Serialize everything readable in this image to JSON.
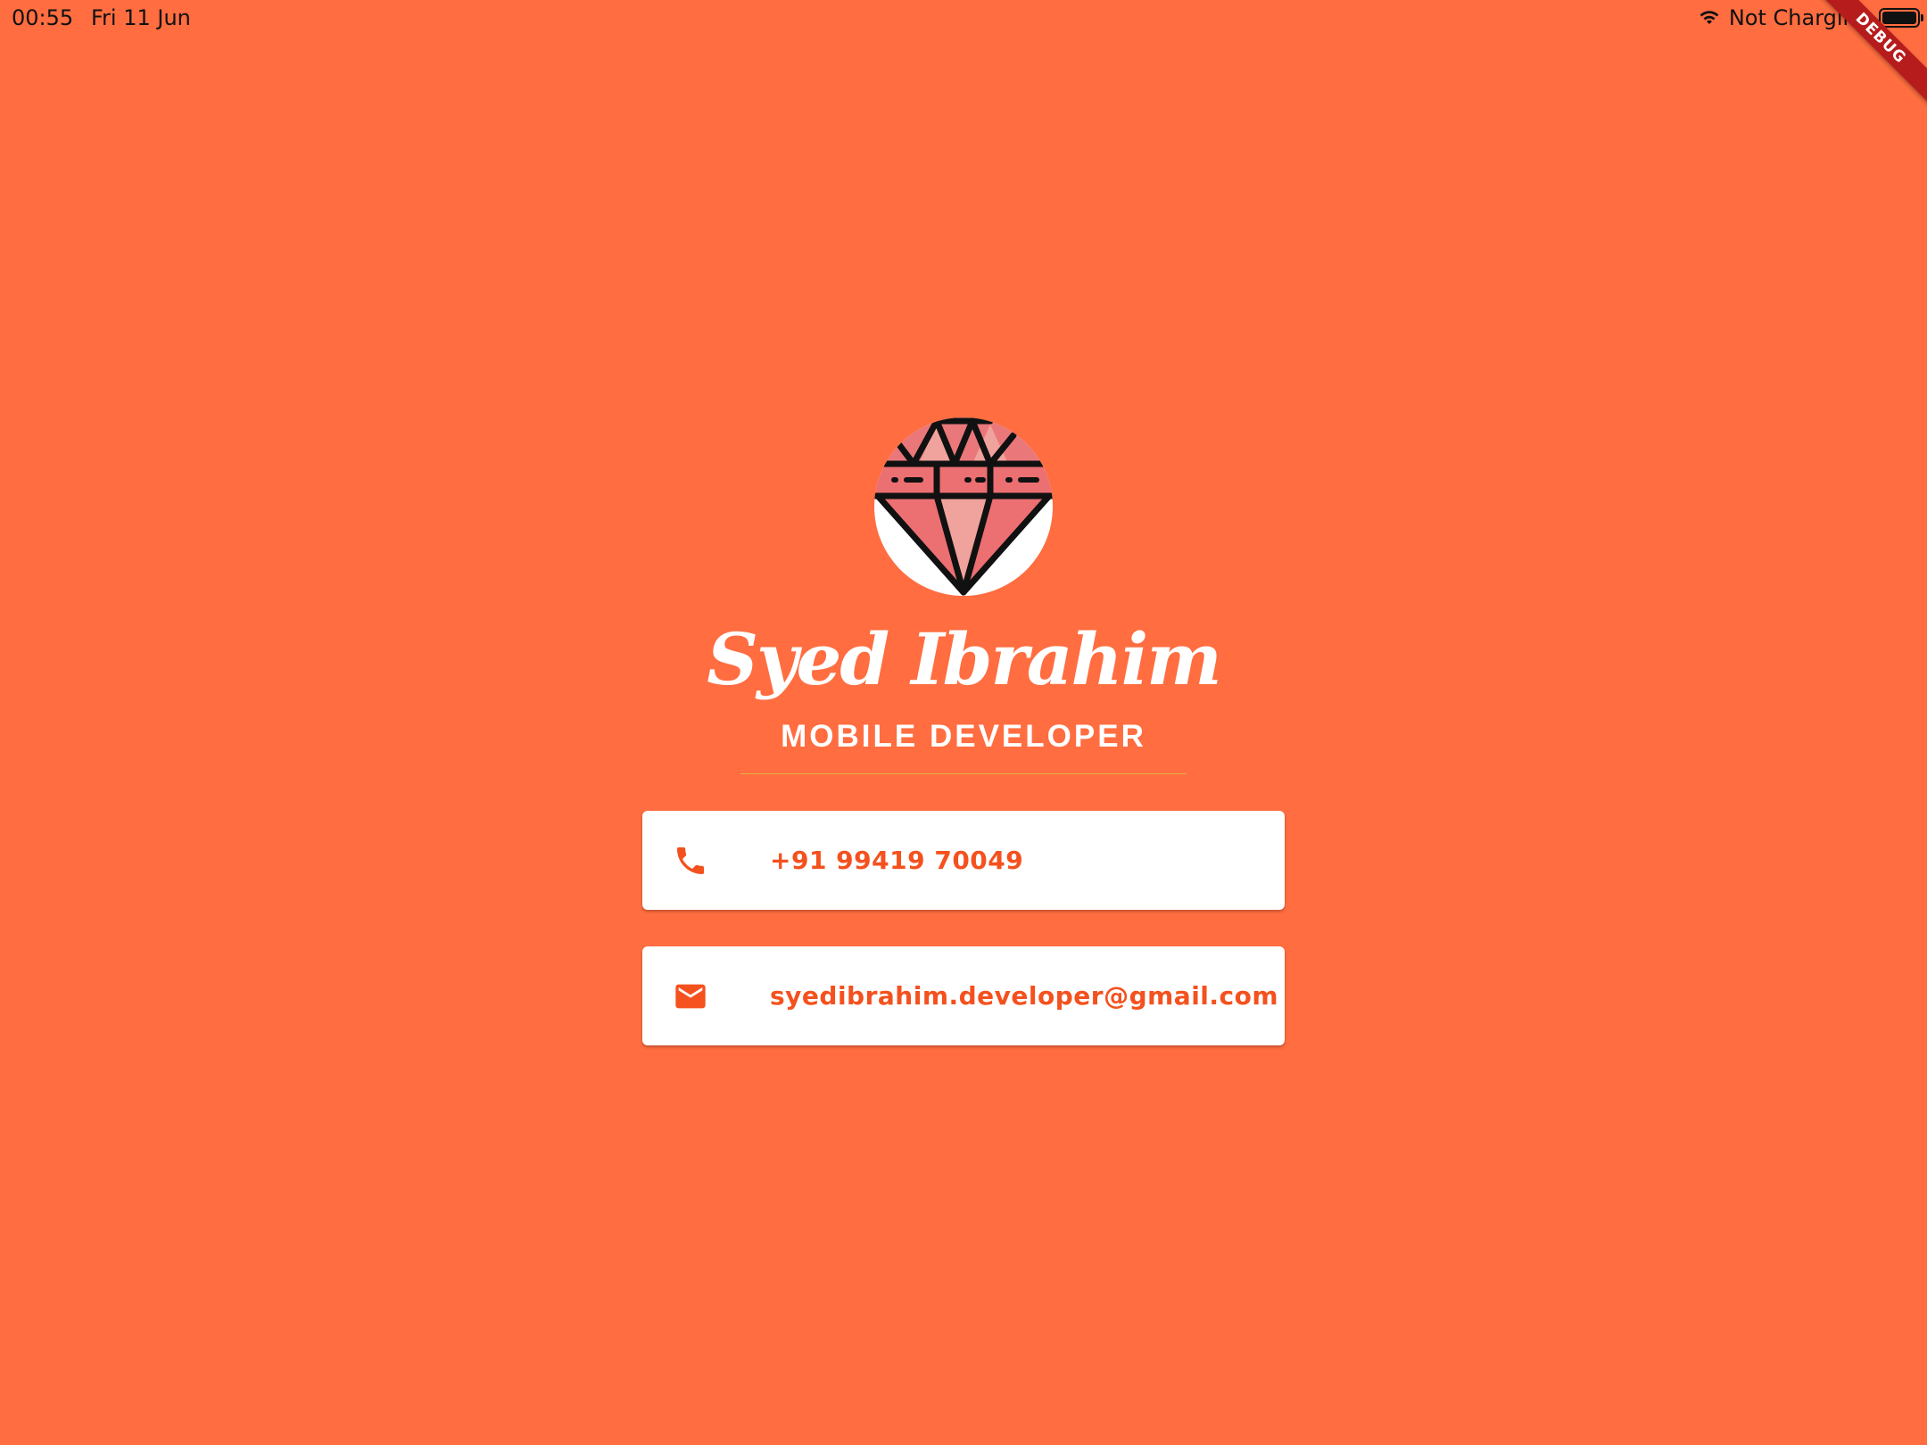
{
  "status_bar": {
    "time": "00:55",
    "date": "Fri 11 Jun",
    "charging": "Not Charging",
    "debug_label": "DEBUG"
  },
  "profile": {
    "avatar_icon": "diamond-icon",
    "name": "Syed Ibrahim",
    "title": "MOBILE DEVELOPER"
  },
  "contacts": {
    "phone": {
      "icon": "phone-icon",
      "value": "+91 99419 70049"
    },
    "email": {
      "icon": "mail-icon",
      "value": "syedibrahim.developer@gmail.com"
    }
  },
  "colors": {
    "background": "#FF6D40",
    "accent": "#F4511E",
    "card": "#FFFFFF",
    "divider": "#E9B43E"
  }
}
